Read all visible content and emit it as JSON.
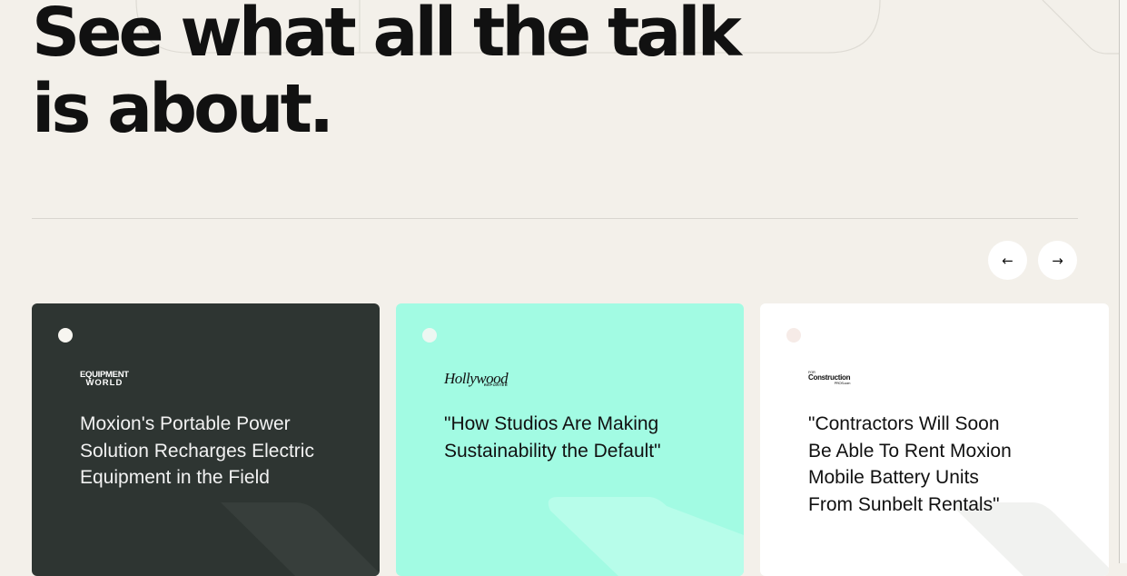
{
  "section": {
    "heading_line1": "See what all the talk",
    "heading_line2": "is about."
  },
  "carousel": {
    "prev_label": "←",
    "next_label": "→"
  },
  "cards": [
    {
      "publication": "Equipment World",
      "logo_line1": "EQUIPMENT",
      "logo_line2": "WORLD",
      "title": "Moxion's Portable Power Solution Recharges Electric Equipment in the Field",
      "background": "#2e3532"
    },
    {
      "publication": "The Hollywood Reporter",
      "logo_main": "Hollywood",
      "logo_sub": "REPORTER",
      "title": "\"How Studios Are Making Sustainability the Default\"",
      "background": "#a2fbe3"
    },
    {
      "publication": "For Construction Pros",
      "logo_small": "FOR",
      "logo_main": "Construction",
      "logo_sub": "PROS.com",
      "title": "\"Contractors Will Soon Be Able To Rent Moxion Mobile Battery Units From Sunbelt Rentals\"",
      "background": "#ffffff"
    }
  ],
  "colors": {
    "page_bg": "#f3f0ea",
    "text": "#111111"
  }
}
